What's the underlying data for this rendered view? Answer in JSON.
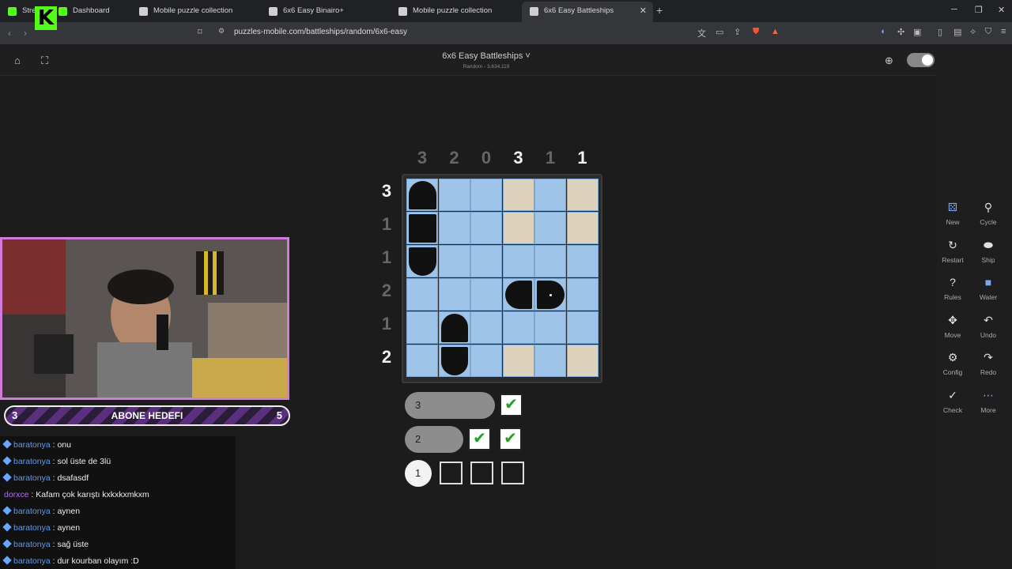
{
  "tabs": [
    {
      "label": "Stre",
      "active": false
    },
    {
      "label": "Dashboard",
      "active": false
    },
    {
      "label": "Mobile puzzle collection",
      "active": false
    },
    {
      "label": "6x6 Easy Binairo+",
      "active": false
    },
    {
      "label": "Mobile puzzle collection",
      "active": false
    },
    {
      "label": "6x6 Easy Battleships",
      "active": true
    }
  ],
  "address": {
    "url": "puzzles-mobile.com/battleships/random/6x6-easy"
  },
  "header": {
    "title": "6x6 Easy Battleships ˅",
    "subtitle": "Random - 3,634,119"
  },
  "puzzle": {
    "column_counts": [
      "3",
      "2",
      "0",
      "3",
      "1",
      "1"
    ],
    "column_done": [
      false,
      false,
      false,
      true,
      false,
      true
    ],
    "row_counts": [
      "3",
      "1",
      "1",
      "2",
      "1",
      "2"
    ],
    "row_done": [
      true,
      false,
      false,
      false,
      false,
      true
    ],
    "grid": [
      [
        "ship",
        "water",
        "water",
        "unknown",
        "water",
        "unknown"
      ],
      [
        "ship",
        "water",
        "water",
        "unknown",
        "water",
        "unknown"
      ],
      [
        "ship",
        "water",
        "water",
        "water",
        "water",
        "water"
      ],
      [
        "water",
        "water",
        "water",
        "ship",
        "ship",
        "water"
      ],
      [
        "water",
        "ship",
        "water",
        "water",
        "water",
        "water"
      ],
      [
        "water",
        "ship",
        "water",
        "unknown",
        "water",
        "unknown"
      ]
    ],
    "fleet": [
      {
        "size": "3",
        "checks": [
          true
        ]
      },
      {
        "size": "2",
        "checks": [
          true,
          true
        ]
      },
      {
        "size": "1",
        "checks": [
          false,
          false,
          false
        ]
      }
    ]
  },
  "toolbar": [
    {
      "label": "New",
      "icon": "new-icon"
    },
    {
      "label": "Cycle",
      "icon": "cycle-icon"
    },
    {
      "label": "Restart",
      "icon": "restart-icon"
    },
    {
      "label": "Ship",
      "icon": "ship-icon"
    },
    {
      "label": "Rules",
      "icon": "rules-icon"
    },
    {
      "label": "Water",
      "icon": "water-icon"
    },
    {
      "label": "Move",
      "icon": "move-icon"
    },
    {
      "label": "Undo",
      "icon": "undo-icon"
    },
    {
      "label": "Config",
      "icon": "config-icon"
    },
    {
      "label": "Redo",
      "icon": "redo-icon"
    },
    {
      "label": "Check",
      "icon": "check-icon"
    },
    {
      "label": "More",
      "icon": "more-icon"
    }
  ],
  "subgoal": {
    "current": "3",
    "label": "ABONE HEDEFI",
    "target": "5"
  },
  "chat": [
    {
      "user": "baratonya",
      "text": ": onu"
    },
    {
      "user": "baratonya",
      "text": ": sol üste de 3lü"
    },
    {
      "user": "baratonya",
      "text": ": dsafasdf"
    },
    {
      "user": "dorxce",
      "text": ": Kafam çok karıştı kxkxkxmkxm"
    },
    {
      "user": "baratonya",
      "text": ": aynen"
    },
    {
      "user": "baratonya",
      "text": ": aynen"
    },
    {
      "user": "baratonya",
      "text": ": sağ üste"
    },
    {
      "user": "baratonya",
      "text": ": dur kourban olayım :D"
    }
  ],
  "colors": {
    "water": "#9ec4ea",
    "unknown": "#ddd3bd",
    "ship": "#111111",
    "accent": "#53fc18"
  }
}
